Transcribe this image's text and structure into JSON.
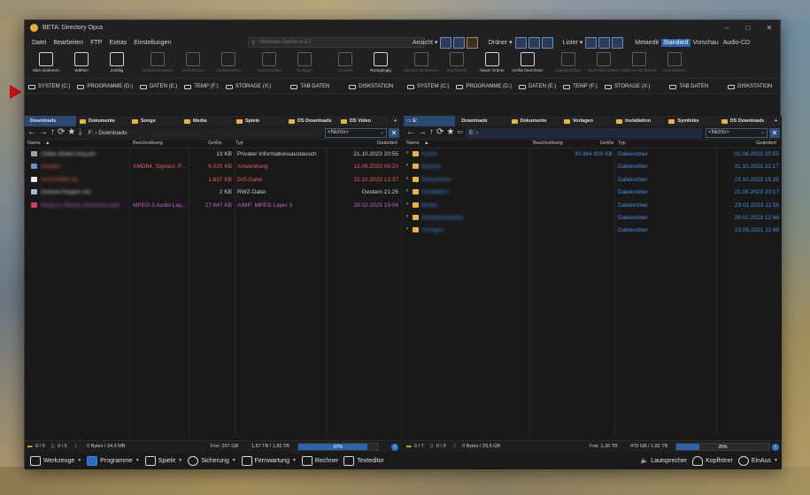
{
  "window": {
    "title": "BETA: Directory Opus"
  },
  "menu": {
    "items": [
      "Datei",
      "Bearbeiten",
      "FTP",
      "Extras",
      "Einstellungen"
    ],
    "search_placeholder": "Windows-Suche in E:\\",
    "ansicht": "Ansicht ▾",
    "ordner": "Ordner ▾",
    "lister": "Lister ▾",
    "tabs": [
      "Metaedit",
      "Standard",
      "Vorschau",
      "Audio-CD"
    ],
    "active_tab": "Standard"
  },
  "toolbar": [
    {
      "label": "Alles markieren",
      "enabled": true
    },
    {
      "label": "Wählen",
      "enabled": true
    },
    {
      "label": "Zufällig",
      "enabled": true
    },
    {
      "label": "Dateien kopieren",
      "enabled": false
    },
    {
      "label": "Verschieben",
      "enabled": false
    },
    {
      "label": "Umbenennen",
      "enabled": false
    },
    {
      "label": "Ausschneiden",
      "enabled": false
    },
    {
      "label": "Einfügen",
      "enabled": false
    },
    {
      "label": "Löschen",
      "enabled": false
    },
    {
      "label": "Rückgängig",
      "enabled": true
    },
    {
      "label": "Dateien archivieren",
      "enabled": false
    },
    {
      "label": "Duplizieren",
      "enabled": false
    },
    {
      "label": "Neuer Ordner",
      "enabled": true
    },
    {
      "label": "Größe berechnen",
      "enabled": true
    },
    {
      "label": "Eigenschaften",
      "enabled": false
    },
    {
      "label": "Nach links drehen",
      "enabled": false
    },
    {
      "label": "Nach rechts drehen",
      "enabled": false
    },
    {
      "label": "Konvertieren",
      "enabled": false
    }
  ],
  "drives": [
    "SYSTEM (C:)",
    "PROGRAMME (D:)",
    "DATEN (E:)",
    "TEMP (F:)",
    "STORAGE (X:)",
    "TAB DATEN",
    "DISKSTATION"
  ],
  "left_pane": {
    "tabs": [
      "Downloads",
      "Dokumente",
      "Songs",
      "Media",
      "Spiele",
      "DS Downloads",
      "DS Video"
    ],
    "active_tab": "Downloads",
    "path": "F: › Downloads",
    "filter": "<Nichts>",
    "columns": {
      "name": "Name",
      "desc": "Beschreibung",
      "size": "Größe",
      "type": "Typ",
      "changed": "Geändert"
    },
    "rows": [
      {
        "name": "Chiller-Brillen-Key.pfx",
        "desc": "",
        "size": "13 KB",
        "type": "Privater Informationsaustausch",
        "changed": "21.10.2023  20:55",
        "color": "#d0d0d0",
        "icon": "#9aa4ae"
      },
      {
        "name": "Installer",
        "desc": "AMD64, Signiert, P...",
        "size": "6.025 KB",
        "type": "Anwendung",
        "changed": "13.09.2023  06:20",
        "color": "#e06060",
        "icon": "#6a8fc8"
      },
      {
        "name": "FILENAME.dis",
        "desc": "",
        "size": "1.637 KB",
        "type": "DIS-Datei",
        "changed": "22.10.2023  13:37",
        "color": "#e06060",
        "icon": "#e8e8e8"
      },
      {
        "name": "Outlook-Regeln.rwz",
        "desc": "",
        "size": "2 KB",
        "type": "RWZ-Datei",
        "changed": "Gestern  21:25",
        "color": "#d0d0d0",
        "icon": "#a8b8cc"
      },
      {
        "name": "Song (1-Album) (Preview).mp3",
        "desc": "MPEG-1 Audio Lay...",
        "size": "27.647 KB",
        "type": "AIMP: MPEG Layer 3",
        "changed": "28.02.2023  19:04",
        "color": "#c060c8",
        "icon": "#d04060"
      }
    ],
    "status": {
      "folders": "0 / 0",
      "files": "0 / 5",
      "files_red": "1",
      "bytes": "0 Bytes / 34,9 MB",
      "free": "Frei:  257 GB",
      "usage": "1,57 TB / 1,82 TB",
      "percent_label": "87%",
      "percent": 87
    }
  },
  "right_pane": {
    "tabs": [
      "E:",
      "Downloads",
      "Dokumente",
      "Vorlagen",
      "Installation",
      "Symlinks",
      "DS Downloads"
    ],
    "active_tab": "E:",
    "path": "E: ›",
    "filter": "<Nichts>",
    "columns": {
      "name": "Name",
      "desc": "Beschreibung",
      "size": "Größe",
      "type": "Typ",
      "changed": "Geändert"
    },
    "rows": [
      {
        "name": "Archiv",
        "size": "30.964.800 KB",
        "type": "Dateiordner",
        "changed": "01.08.2023  20:55"
      },
      {
        "name": "Backup",
        "size": "",
        "type": "Dateiordner",
        "changed": "21.10.2023  22:17"
      },
      {
        "name": "Dokumente",
        "size": "",
        "type": "Dateiordner",
        "changed": "23.10.2023  15:35"
      },
      {
        "name": "Installation",
        "size": "",
        "type": "Dateiordner",
        "changed": "21.06.2023  20:17"
      },
      {
        "name": "Media",
        "size": "",
        "type": "Dateiordner",
        "changed": "29.01.2023  11:56"
      },
      {
        "name": "Musikproduktion",
        "size": "",
        "type": "Dateiordner",
        "changed": "29.01.2023  12:48"
      },
      {
        "name": "Vorlagen",
        "size": "",
        "type": "Dateiordner",
        "changed": "23.05.2021  11:48"
      }
    ],
    "status": {
      "folders": "0 / 7",
      "files": "0 / 0",
      "files_red": "2",
      "bytes": "0 Bytes / 29,5 GB",
      "free": "Frei:  1,36 TB",
      "usage": "470 GB / 1,82 TB",
      "percent_label": "25%",
      "percent": 25
    }
  },
  "bottombar": {
    "left": [
      "Werkzeuge",
      "Programme",
      "Spiele",
      "Sicherung",
      "Fernwartung",
      "Rechner",
      "Texteditor"
    ],
    "right": [
      "Lautsprecher",
      "Kopfhörer",
      "EinAus"
    ]
  },
  "colors": {
    "accent": "#2f63a8",
    "folder": "#e8b543",
    "highlight_blue": "#4a90e0",
    "red_arrow": "#d01010"
  }
}
